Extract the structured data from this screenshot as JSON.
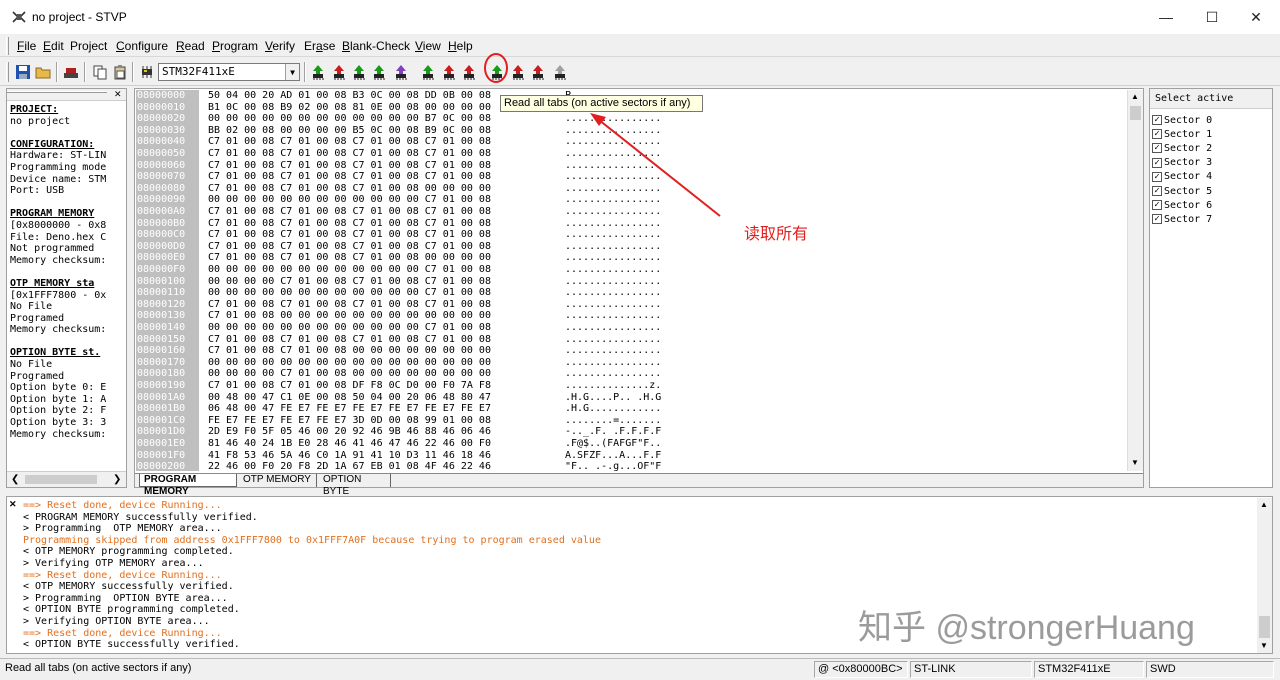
{
  "window": {
    "title": "no project - STVP",
    "minimize": "—",
    "maximize": "☐",
    "close": "✕"
  },
  "menu": [
    {
      "pre": "",
      "u": "F",
      "post": "ile"
    },
    {
      "pre": "",
      "u": "E",
      "post": "dit"
    },
    {
      "pre": "Pro",
      "u": "j",
      "post": "ect"
    },
    {
      "pre": "",
      "u": "C",
      "post": "onfigure"
    },
    {
      "pre": "",
      "u": "R",
      "post": "ead"
    },
    {
      "pre": "",
      "u": "P",
      "post": "rogram"
    },
    {
      "pre": "",
      "u": "V",
      "post": "erify"
    },
    {
      "pre": "Er",
      "u": "a",
      "post": "se"
    },
    {
      "pre": "",
      "u": "B",
      "post": "lank-Check"
    },
    {
      "pre": "",
      "u": "V",
      "post": "iew"
    },
    {
      "pre": "",
      "u": "H",
      "post": "elp"
    }
  ],
  "toolbar": {
    "device": "STM32F411xE",
    "dropdown_arrow": "▼"
  },
  "tooltip": "Read all tabs (on active sectors if any)",
  "annotation": "读取所有",
  "left_panel": {
    "close": "✕",
    "lines": [
      {
        "t": "PROJECT:",
        "h": true
      },
      {
        "t": "no project",
        "h": false
      },
      {
        "t": "",
        "h": false
      },
      {
        "t": "CONFIGURATION:",
        "h": true
      },
      {
        "t": "Hardware: ST-LIN",
        "h": false
      },
      {
        "t": "Programming mode",
        "h": false
      },
      {
        "t": "Device name: STM",
        "h": false
      },
      {
        "t": "Port: USB",
        "h": false
      },
      {
        "t": "",
        "h": false
      },
      {
        "t": "PROGRAM MEMORY",
        "h": true
      },
      {
        "t": "[0x8000000 - 0x8",
        "h": false
      },
      {
        "t": "File: Deno.hex C",
        "h": false
      },
      {
        "t": "Not programmed",
        "h": false
      },
      {
        "t": "Memory checksum:",
        "h": false
      },
      {
        "t": "",
        "h": false
      },
      {
        "t": "OTP MEMORY sta",
        "h": true
      },
      {
        "t": "[0x1FFF7800 - 0x",
        "h": false
      },
      {
        "t": "No File",
        "h": false
      },
      {
        "t": "Programed",
        "h": false
      },
      {
        "t": "Memory checksum:",
        "h": false
      },
      {
        "t": "",
        "h": false
      },
      {
        "t": "OPTION BYTE st.",
        "h": true
      },
      {
        "t": "No File",
        "h": false
      },
      {
        "t": "Programed",
        "h": false
      },
      {
        "t": "Option byte 0: E",
        "h": false
      },
      {
        "t": "Option byte 1: A",
        "h": false
      },
      {
        "t": "Option byte 2: F",
        "h": false
      },
      {
        "t": "Option byte 3: 3",
        "h": false
      },
      {
        "t": "Memory checksum:",
        "h": false
      }
    ]
  },
  "hex": {
    "rows": [
      {
        "addr": "08000000",
        "bytes": "50 04 00 20 AD 01 00 08 B3 0C 00 08 DD 0B 00 08",
        "ascii": "P"
      },
      {
        "addr": "08000010",
        "bytes": "B1 0C 00 08 B9 02 00 08 81 0E 00 08 00 00 00 00",
        "ascii": ""
      },
      {
        "addr": "08000020",
        "bytes": "00 00 00 00 00 00 00 00 00 00 00 00 B7 0C 00 08",
        "ascii": "................"
      },
      {
        "addr": "08000030",
        "bytes": "BB 02 00 08 00 00 00 00 B5 0C 00 08 B9 0C 00 08",
        "ascii": "................"
      },
      {
        "addr": "08000040",
        "bytes": "C7 01 00 08 C7 01 00 08 C7 01 00 08 C7 01 00 08",
        "ascii": "................"
      },
      {
        "addr": "08000050",
        "bytes": "C7 01 00 08 C7 01 00 08 C7 01 00 08 C7 01 00 08",
        "ascii": "................"
      },
      {
        "addr": "08000060",
        "bytes": "C7 01 00 08 C7 01 00 08 C7 01 00 08 C7 01 00 08",
        "ascii": "................"
      },
      {
        "addr": "08000070",
        "bytes": "C7 01 00 08 C7 01 00 08 C7 01 00 08 C7 01 00 08",
        "ascii": "................"
      },
      {
        "addr": "08000080",
        "bytes": "C7 01 00 08 C7 01 00 08 C7 01 00 08 00 00 00 00",
        "ascii": "................"
      },
      {
        "addr": "08000090",
        "bytes": "00 00 00 00 00 00 00 00 00 00 00 00 C7 01 00 08",
        "ascii": "................"
      },
      {
        "addr": "080000A0",
        "bytes": "C7 01 00 08 C7 01 00 08 C7 01 00 08 C7 01 00 08",
        "ascii": "................"
      },
      {
        "addr": "080000B0",
        "bytes": "C7 01 00 08 C7 01 00 08 C7 01 00 08 C7 01 00 08",
        "ascii": "................"
      },
      {
        "addr": "080000C0",
        "bytes": "C7 01 00 08 C7 01 00 08 C7 01 00 08 C7 01 00 08",
        "ascii": "................"
      },
      {
        "addr": "080000D0",
        "bytes": "C7 01 00 08 C7 01 00 08 C7 01 00 08 C7 01 00 08",
        "ascii": "................"
      },
      {
        "addr": "080000E0",
        "bytes": "C7 01 00 08 C7 01 00 08 C7 01 00 08 00 00 00 00",
        "ascii": "................"
      },
      {
        "addr": "080000F0",
        "bytes": "00 00 00 00 00 00 00 00 00 00 00 00 C7 01 00 08",
        "ascii": "................"
      },
      {
        "addr": "08000100",
        "bytes": "00 00 00 00 C7 01 00 08 C7 01 00 08 C7 01 00 08",
        "ascii": "................"
      },
      {
        "addr": "08000110",
        "bytes": "00 00 00 00 00 00 00 00 00 00 00 00 C7 01 00 08",
        "ascii": "................"
      },
      {
        "addr": "08000120",
        "bytes": "C7 01 00 08 C7 01 00 08 C7 01 00 08 C7 01 00 08",
        "ascii": "................"
      },
      {
        "addr": "08000130",
        "bytes": "C7 01 00 08 00 00 00 00 00 00 00 00 00 00 00 00",
        "ascii": "................"
      },
      {
        "addr": "08000140",
        "bytes": "00 00 00 00 00 00 00 00 00 00 00 00 C7 01 00 08",
        "ascii": "................"
      },
      {
        "addr": "08000150",
        "bytes": "C7 01 00 08 C7 01 00 08 C7 01 00 08 C7 01 00 08",
        "ascii": "................"
      },
      {
        "addr": "08000160",
        "bytes": "C7 01 00 08 C7 01 00 08 00 00 00 00 00 00 00 00",
        "ascii": "................"
      },
      {
        "addr": "08000170",
        "bytes": "00 00 00 00 00 00 00 00 00 00 00 00 00 00 00 00",
        "ascii": "................"
      },
      {
        "addr": "08000180",
        "bytes": "00 00 00 00 C7 01 00 08 00 00 00 00 00 00 00 00",
        "ascii": "................"
      },
      {
        "addr": "08000190",
        "bytes": "C7 01 00 08 C7 01 00 08 DF F8 0C D0 00 F0 7A F8",
        "ascii": "..............z."
      },
      {
        "addr": "080001A0",
        "bytes": "00 48 00 47 C1 0E 00 08 50 04 00 20 06 48 80 47",
        "ascii": ".H.G....P.. .H.G"
      },
      {
        "addr": "080001B0",
        "bytes": "06 48 00 47 FE E7 FE E7 FE E7 FE E7 FE E7 FE E7",
        "ascii": ".H.G............"
      },
      {
        "addr": "080001C0",
        "bytes": "FE E7 FE E7 FE E7 FE E7 3D 0D 00 08 99 01 00 08",
        "ascii": "........=......."
      },
      {
        "addr": "080001D0",
        "bytes": "2D E9 F0 5F 05 46 00 20 92 46 9B 46 88 46 06 46",
        "ascii": "-.._.F. .F.F.F.F"
      },
      {
        "addr": "080001E0",
        "bytes": "81 46 40 24 1B E0 28 46 41 46 47 46 22 46 00 F0",
        "ascii": ".F@$..(FAFGF\"F.."
      },
      {
        "addr": "080001F0",
        "bytes": "41 F8 53 46 5A 46 C0 1A 91 41 10 D3 11 46 18 46",
        "ascii": "A.SFZF...A...F.F"
      },
      {
        "addr": "08000200",
        "bytes": "22 46 00 F0 20 F8 2D 1A 67 EB 01 08 4F 46 22 46",
        "ascii": "\"F.. .-.g...OF\"F"
      }
    ]
  },
  "tabs": [
    "PROGRAM MEMORY",
    "OTP MEMORY",
    "OPTION BYTE"
  ],
  "right_panel": {
    "header": "Select active",
    "sectors": [
      "Sector 0",
      "Sector 1",
      "Sector 2",
      "Sector 3",
      "Sector 4",
      "Sector 5",
      "Sector 6",
      "Sector 7"
    ],
    "check": "✓"
  },
  "log": {
    "close": "✕",
    "lines": [
      {
        "t": "==> Reset done, device Running...",
        "c": "#e07020"
      },
      {
        "t": "< PROGRAM MEMORY successfully verified.",
        "c": "#000000"
      },
      {
        "t": "> Programming  OTP MEMORY area...",
        "c": "#000000"
      },
      {
        "t": "Programming skipped from address 0x1FFF7800 to 0x1FFF7A0F because trying to program erased value",
        "c": "#e07020"
      },
      {
        "t": "< OTP MEMORY programming completed.",
        "c": "#000000"
      },
      {
        "t": "> Verifying OTP MEMORY area...",
        "c": "#000000"
      },
      {
        "t": "==> Reset done, device Running...",
        "c": "#e07020"
      },
      {
        "t": "< OTP MEMORY successfully verified.",
        "c": "#000000"
      },
      {
        "t": "> Programming  OPTION BYTE area...",
        "c": "#000000"
      },
      {
        "t": "< OPTION BYTE programming completed.",
        "c": "#000000"
      },
      {
        "t": "> Verifying OPTION BYTE area...",
        "c": "#000000"
      },
      {
        "t": "==> Reset done, device Running...",
        "c": "#e07020"
      },
      {
        "t": "< OPTION BYTE successfully verified.",
        "c": "#000000"
      }
    ]
  },
  "watermark": "知乎 @strongerHuang",
  "status": {
    "message": "Read all tabs (on active sectors if any)",
    "address": "@ <0x80000BC>",
    "hardware": "ST-LINK",
    "device": "STM32F411xE",
    "protocol": "SWD"
  },
  "colors": {
    "annotation": "#e02020",
    "log_warning": "#e07020",
    "chip_green": "#1a9a1a",
    "chip_red": "#c81e1e"
  }
}
